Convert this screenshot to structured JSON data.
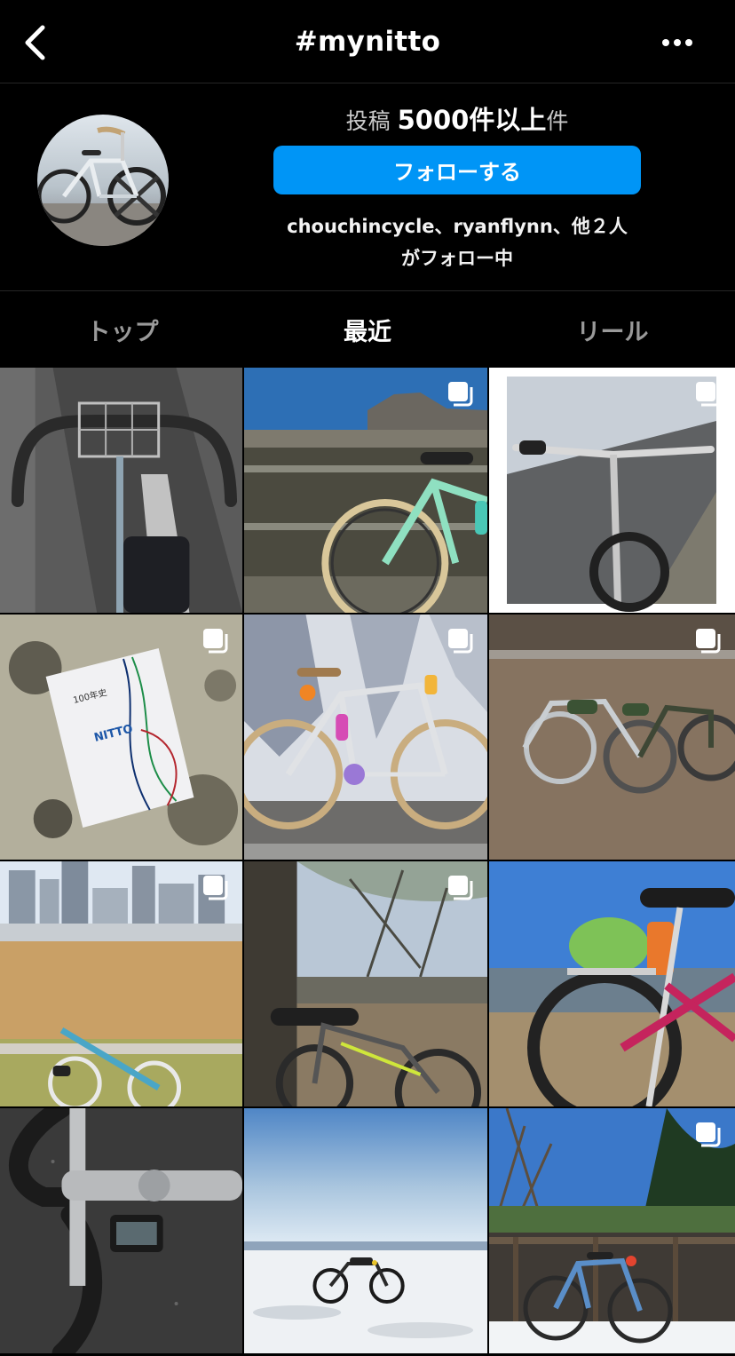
{
  "header": {
    "title": "#mynitto",
    "back_icon": "chevron-left-icon",
    "more_icon": "more-horizontal-icon"
  },
  "profile": {
    "posts_prefix": "投稿",
    "posts_count": "5000",
    "posts_suffix": "件以上件",
    "follow_label": "フォローする",
    "followed_by_line1": "chouchincycle、ryanflynn、他２人",
    "followed_by_line2": "がフォロー中"
  },
  "tabs": [
    {
      "label": "トップ",
      "active": false
    },
    {
      "label": "最近",
      "active": true
    },
    {
      "label": "リール",
      "active": false
    }
  ],
  "grid": {
    "posts": [
      {
        "subject": "drop handlebar with front basket",
        "multi": false
      },
      {
        "subject": "mint bicycle by railing with mountains",
        "multi": true
      },
      {
        "subject": "handlebar view on path",
        "multi": true
      },
      {
        "subject": "NITTO 100 year history booklet",
        "multi": true
      },
      {
        "subject": "silver bicycle with orange bottle",
        "multi": true
      },
      {
        "subject": "two touring bicycles on grass",
        "multi": true
      },
      {
        "subject": "bicycle lying in dry field with city skyline",
        "multi": true
      },
      {
        "subject": "bicycle under tree in park",
        "multi": true
      },
      {
        "subject": "red bicycle with cabbage on rack",
        "multi": false
      },
      {
        "subject": "stem and handlebar top view",
        "multi": false
      },
      {
        "subject": "bicycle on snowy beach",
        "multi": false
      },
      {
        "subject": "blue bicycle by fence in snow",
        "multi": true
      }
    ],
    "booklet_title": "100年史",
    "booklet_brand": "NITTO"
  },
  "colors": {
    "background": "#000000",
    "accent": "#0095f6",
    "tab_inactive": "#9a9a9a"
  }
}
